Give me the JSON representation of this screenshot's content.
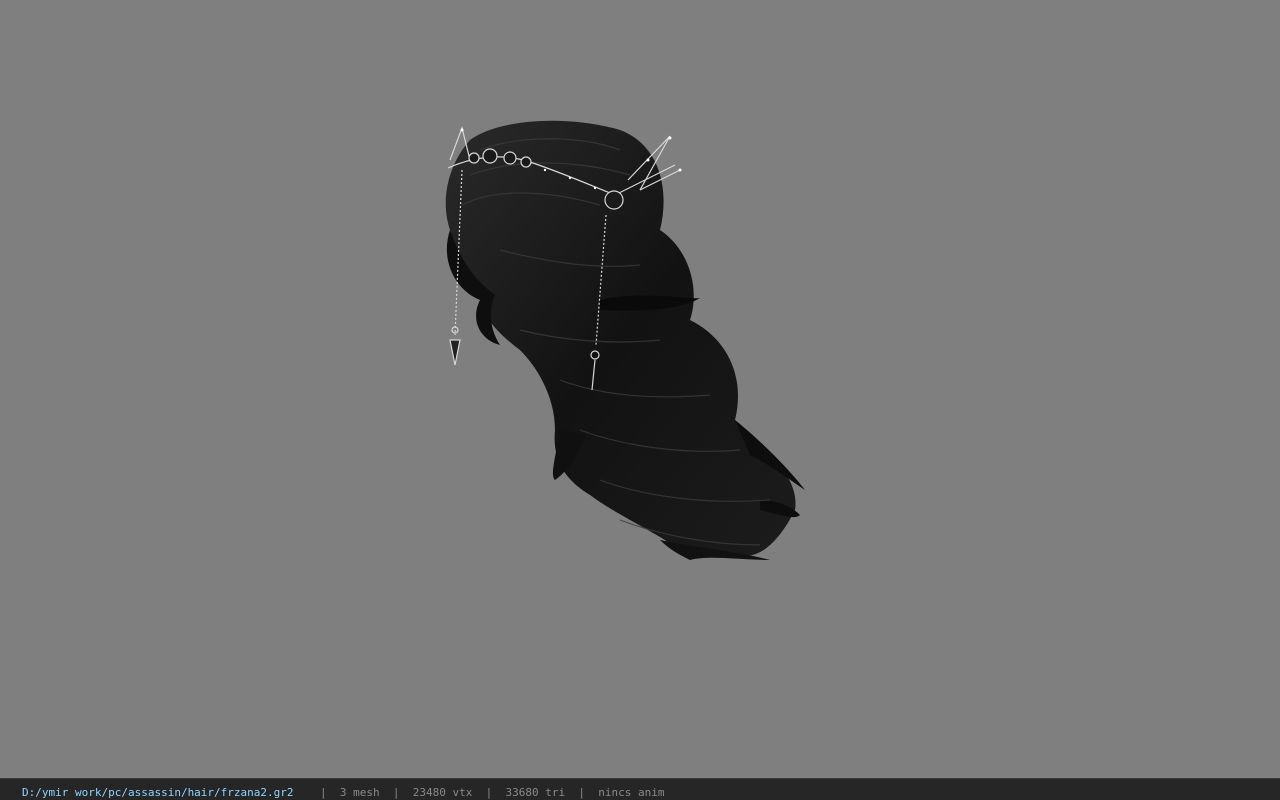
{
  "viewport": {
    "background_color": "#7f7f7f",
    "model": "hair-with-tiara-mesh"
  },
  "status_bar": {
    "file_path": "D:/ymir work/pc/assassin/hair/frzana2.gr2",
    "separator": "|",
    "mesh_count": "3 mesh",
    "vertex_count": "23480 vtx",
    "triangle_count": "33680 tri",
    "anim_status": "nincs anim",
    "path_color": "#8fd3ff",
    "text_color": "#8a8a8a"
  }
}
